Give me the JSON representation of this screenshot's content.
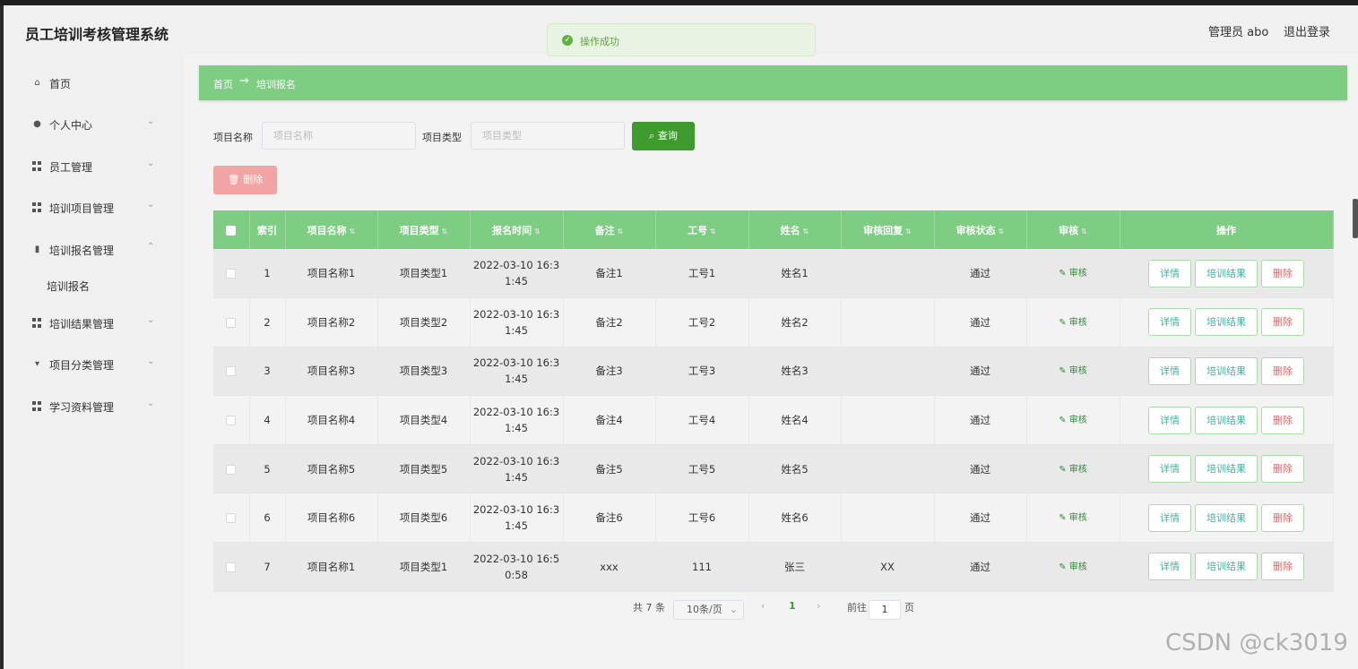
{
  "app": {
    "title": "员工培训考核管理系统",
    "admin_label": "管理员 abo",
    "logout_label": "退出登录"
  },
  "toast": {
    "message": "操作成功"
  },
  "sidebar": {
    "items": [
      {
        "label": "首页"
      },
      {
        "label": "个人中心"
      },
      {
        "label": "员工管理"
      },
      {
        "label": "培训项目管理"
      },
      {
        "label": "培训报名管理"
      },
      {
        "label": "培训结果管理"
      },
      {
        "label": "项目分类管理"
      },
      {
        "label": "学习资料管理"
      }
    ],
    "sub_item": "培训报名"
  },
  "breadcrumb": {
    "home": "首页",
    "arrow": "→",
    "current": "培训报名"
  },
  "search": {
    "name_label": "项目名称",
    "name_placeholder": "项目名称",
    "type_label": "项目类型",
    "type_placeholder": "项目类型",
    "query_label": "查询"
  },
  "toolbar": {
    "delete_label": "删除"
  },
  "table": {
    "headers": [
      "索引",
      "项目名称",
      "项目类型",
      "报名时间",
      "备注",
      "工号",
      "姓名",
      "审核回复",
      "审核状态",
      "审核",
      "操作"
    ],
    "rows": [
      {
        "index": "1",
        "name": "项目名称1",
        "type": "项目类型1",
        "time1": "2022-03-10 16:3",
        "time2": "1:45",
        "remark": "备注1",
        "id": "工号1",
        "person": "姓名1",
        "reply": "",
        "status": "通过"
      },
      {
        "index": "2",
        "name": "项目名称2",
        "type": "项目类型2",
        "time1": "2022-03-10 16:3",
        "time2": "1:45",
        "remark": "备注2",
        "id": "工号2",
        "person": "姓名2",
        "reply": "",
        "status": "通过"
      },
      {
        "index": "3",
        "name": "项目名称3",
        "type": "项目类型3",
        "time1": "2022-03-10 16:3",
        "time2": "1:45",
        "remark": "备注3",
        "id": "工号3",
        "person": "姓名3",
        "reply": "",
        "status": "通过"
      },
      {
        "index": "4",
        "name": "项目名称4",
        "type": "项目类型4",
        "time1": "2022-03-10 16:3",
        "time2": "1:45",
        "remark": "备注4",
        "id": "工号4",
        "person": "姓名4",
        "reply": "",
        "status": "通过"
      },
      {
        "index": "5",
        "name": "项目名称5",
        "type": "项目类型5",
        "time1": "2022-03-10 16:3",
        "time2": "1:45",
        "remark": "备注5",
        "id": "工号5",
        "person": "姓名5",
        "reply": "",
        "status": "通过"
      },
      {
        "index": "6",
        "name": "项目名称6",
        "type": "项目类型6",
        "time1": "2022-03-10 16:3",
        "time2": "1:45",
        "remark": "备注6",
        "id": "工号6",
        "person": "姓名6",
        "reply": "",
        "status": "通过"
      },
      {
        "index": "7",
        "name": "项目名称1",
        "type": "项目类型1",
        "time1": "2022-03-10 16:5",
        "time2": "0:58",
        "remark": "xxx",
        "id": "111",
        "person": "张三",
        "reply": "XX",
        "status": "通过"
      }
    ],
    "audit_label": "审核",
    "op_detail": "详情",
    "op_result": "培训结果",
    "op_delete": "删除"
  },
  "pagination": {
    "total": "共 7 条",
    "page_size": "10条/页",
    "current_page": "1",
    "goto_label": "前往",
    "goto_value": "1",
    "page_suffix": "页"
  },
  "watermark": "CSDN @ck3019",
  "colors": {
    "accent": "#7dcd82",
    "query": "#3d9c2d",
    "danger": "#f2a3a3"
  }
}
